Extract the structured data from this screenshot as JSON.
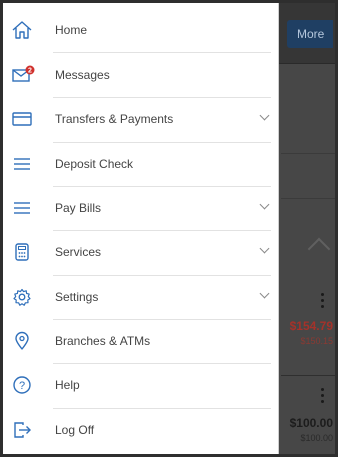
{
  "app": {
    "more_button": "More",
    "amount_1": "$154.79",
    "amount_1_sub": "$150.15",
    "amount_1_color": "#c0392b",
    "amount_2": "$100.00",
    "amount_2_sub": "$100.00"
  },
  "menu": {
    "accent_color": "#2f6fba",
    "items": [
      {
        "label": "Home",
        "icon": "home-icon",
        "chevron": false
      },
      {
        "label": "Messages",
        "icon": "envelope-icon",
        "chevron": false,
        "badge": "2"
      },
      {
        "label": "Transfers & Payments",
        "icon": "card-icon",
        "chevron": true
      },
      {
        "label": "Deposit Check",
        "icon": "menu-lines-icon",
        "chevron": false
      },
      {
        "label": "Pay Bills",
        "icon": "menu-lines-icon",
        "chevron": true
      },
      {
        "label": "Services",
        "icon": "calculator-icon",
        "chevron": true
      },
      {
        "label": "Settings",
        "icon": "gear-icon",
        "chevron": true
      },
      {
        "label": "Branches & ATMs",
        "icon": "location-pin-icon",
        "chevron": false
      },
      {
        "label": "Help",
        "icon": "help-icon",
        "chevron": false
      },
      {
        "label": "Log Off",
        "icon": "logout-icon",
        "chevron": false
      }
    ]
  }
}
